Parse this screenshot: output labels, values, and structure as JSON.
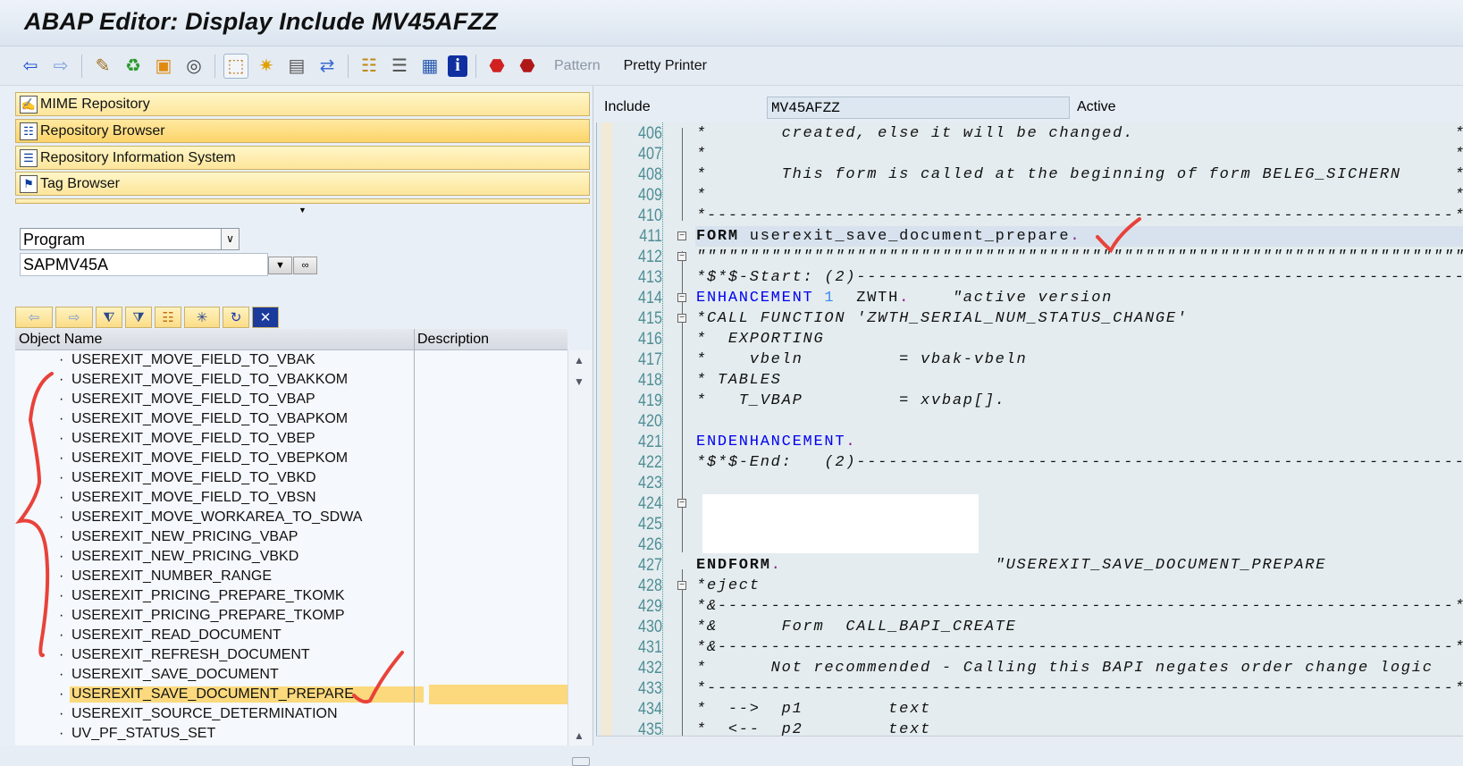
{
  "window": {
    "title": "ABAP Editor: Display Include MV45AFZZ"
  },
  "toolbar": {
    "icons": [
      "back-icon",
      "forward-icon",
      "check-icon",
      "activate-icon",
      "where-used-icon",
      "test-icon",
      "display-object-list-icon",
      "breakpoint-icon",
      "navigation-window-icon",
      "other-object-icon",
      "hierarchy-icon",
      "stack-icon",
      "list-icon",
      "info-icon",
      "stop-icon",
      "stop-user-icon"
    ],
    "pattern_label": "Pattern",
    "pretty_printer_label": "Pretty Printer"
  },
  "navigator": {
    "buttons": [
      {
        "label": "MIME Repository",
        "icon": "mime-icon"
      },
      {
        "label": "Repository Browser",
        "icon": "repository-browser-icon"
      },
      {
        "label": "Repository Information System",
        "icon": "info-system-icon"
      },
      {
        "label": "Tag Browser",
        "icon": "tag-browser-icon"
      }
    ],
    "object_type": "Program",
    "object_name": "SAPMV45A",
    "columns": [
      "Object Name",
      "Description"
    ],
    "items": [
      "USEREXIT_MOVE_FIELD_TO_VBAK",
      "USEREXIT_MOVE_FIELD_TO_VBAKKOM",
      "USEREXIT_MOVE_FIELD_TO_VBAP",
      "USEREXIT_MOVE_FIELD_TO_VBAPKOM",
      "USEREXIT_MOVE_FIELD_TO_VBEP",
      "USEREXIT_MOVE_FIELD_TO_VBEPKOM",
      "USEREXIT_MOVE_FIELD_TO_VBKD",
      "USEREXIT_MOVE_FIELD_TO_VBSN",
      "USEREXIT_MOVE_WORKAREA_TO_SDWA",
      "USEREXIT_NEW_PRICING_VBAP",
      "USEREXIT_NEW_PRICING_VBKD",
      "USEREXIT_NUMBER_RANGE",
      "USEREXIT_PRICING_PREPARE_TKOMK",
      "USEREXIT_PRICING_PREPARE_TKOMP",
      "USEREXIT_READ_DOCUMENT",
      "USEREXIT_REFRESH_DOCUMENT",
      "USEREXIT_SAVE_DOCUMENT",
      "USEREXIT_SAVE_DOCUMENT_PREPARE",
      "USEREXIT_SOURCE_DETERMINATION",
      "UV_PF_STATUS_SET"
    ],
    "selected_index": 17
  },
  "editor": {
    "include_label": "Include",
    "include_name": "MV45AFZZ",
    "status": "Active",
    "highlight_line": 411,
    "lines": [
      {
        "n": "406",
        "segs": [
          [
            "*       created, else it will be changed.                              *",
            "cm"
          ]
        ]
      },
      {
        "n": "407",
        "segs": [
          [
            "*                                                                      *",
            "cm"
          ]
        ]
      },
      {
        "n": "408",
        "segs": [
          [
            "*       This form is called at the beginning of form BELEG_SICHERN     *",
            "cm"
          ]
        ]
      },
      {
        "n": "409",
        "segs": [
          [
            "*                                                                      *",
            "cm"
          ]
        ]
      },
      {
        "n": "410",
        "segs": [
          [
            "*----------------------------------------------------------------------*",
            "cm"
          ]
        ]
      },
      {
        "n": "411",
        "segs": [
          [
            "FORM",
            "bold"
          ],
          [
            " userexit_save_document_prepare",
            ""
          ],
          [
            ".",
            "per"
          ]
        ]
      },
      {
        "n": "412",
        "segs": [
          [
            "\"\"\"\"\"\"\"\"\"\"\"\"\"\"\"\"\"\"\"\"\"\"\"\"\"\"\"\"\"\"\"\"\"\"\"\"\"\"\"\"\"\"\"\"\"\"\"\"\"\"\"\"\"\"\"\"\"\"\"\"\"\"\"\"\"\"\"\"\"\"\"\"",
            "cm"
          ]
        ]
      },
      {
        "n": "413",
        "segs": [
          [
            "*$*$-Start: (2)---------------------------------------------------------",
            "cm"
          ]
        ]
      },
      {
        "n": "414",
        "segs": [
          [
            "ENHANCEMENT",
            "kw"
          ],
          [
            " ",
            ""
          ],
          [
            "1",
            "num"
          ],
          [
            "  ZWTH",
            ""
          ],
          [
            ".",
            "per"
          ],
          [
            "    \"active version",
            "cm"
          ]
        ]
      },
      {
        "n": "415",
        "segs": [
          [
            "*CALL FUNCTION 'ZWTH_SERIAL_NUM_STATUS_CHANGE'",
            "cm"
          ]
        ]
      },
      {
        "n": "416",
        "segs": [
          [
            "*  EXPORTING",
            "cm"
          ]
        ]
      },
      {
        "n": "417",
        "segs": [
          [
            "*    vbeln         = vbak-vbeln",
            "cm"
          ]
        ]
      },
      {
        "n": "418",
        "segs": [
          [
            "* TABLES",
            "cm"
          ]
        ]
      },
      {
        "n": "419",
        "segs": [
          [
            "*   T_VBAP         = xvbap[].",
            "cm"
          ]
        ]
      },
      {
        "n": "420",
        "segs": []
      },
      {
        "n": "421",
        "segs": [
          [
            "ENDENHANCEMENT",
            "kw"
          ],
          [
            ".",
            "per"
          ]
        ]
      },
      {
        "n": "422",
        "segs": [
          [
            "*$*$-End:   (2)---------------------------------------------------------",
            "cm"
          ]
        ]
      },
      {
        "n": "423",
        "segs": []
      },
      {
        "n": "424",
        "segs": []
      },
      {
        "n": "425",
        "segs": []
      },
      {
        "n": "426",
        "segs": []
      },
      {
        "n": "427",
        "segs": [
          [
            "ENDFORM",
            "bold"
          ],
          [
            ".",
            "per"
          ],
          [
            "                    \"USEREXIT_SAVE_DOCUMENT_PREPARE",
            "cm"
          ]
        ]
      },
      {
        "n": "428",
        "segs": [
          [
            "*eject",
            "cm"
          ]
        ]
      },
      {
        "n": "429",
        "segs": [
          [
            "*&---------------------------------------------------------------------*",
            "cm"
          ]
        ]
      },
      {
        "n": "430",
        "segs": [
          [
            "*&      Form  CALL_BAPI_CREATE",
            "cm"
          ]
        ]
      },
      {
        "n": "431",
        "segs": [
          [
            "*&---------------------------------------------------------------------*",
            "cm"
          ]
        ]
      },
      {
        "n": "432",
        "segs": [
          [
            "*      Not recommended - Calling this BAPI negates order change logic",
            "cm"
          ]
        ]
      },
      {
        "n": "433",
        "segs": [
          [
            "*----------------------------------------------------------------------*",
            "cm"
          ]
        ]
      },
      {
        "n": "434",
        "segs": [
          [
            "*  -->  p1        text",
            "cm"
          ]
        ]
      },
      {
        "n": "435",
        "segs": [
          [
            "*  <--  p2        text",
            "cm"
          ]
        ]
      }
    ],
    "fold_lines": [
      411,
      412,
      414,
      415,
      424,
      428
    ]
  },
  "colors": {
    "selection": "#fbd97c",
    "annotation": "#e8423a",
    "keyword": "#0000ee"
  }
}
